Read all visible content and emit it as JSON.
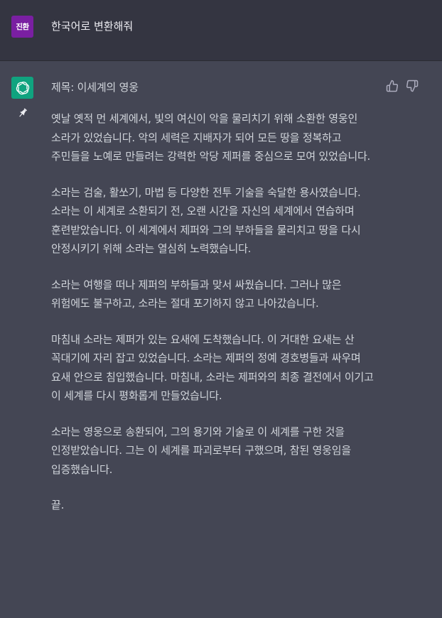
{
  "user": {
    "avatar_text": "진환",
    "avatar_color": "#7a1fa2",
    "message": "한국어로 변환해줘"
  },
  "assistant": {
    "avatar_icon": "openai-logo-icon",
    "avatar_color": "#10a37f",
    "title": "제목: 이세계의 영웅",
    "paragraphs": [
      "옛날 옛적 먼 세계에서, 빛의 여신이 악을 물리치기 위해 소환한 영웅인 소라가 있었습니다. 악의 세력은 지배자가 되어 모든 땅을 정복하고 주민들을 노예로 만들려는 강력한 악당 제퍼를 중심으로 모여 있었습니다.",
      "소라는 검술, 활쏘기, 마법 등 다양한 전투 기술을 숙달한 용사였습니다. 소라는 이 세계로 소환되기 전, 오랜 시간을 자신의 세계에서 연습하며 훈련받았습니다. 이 세계에서 제퍼와 그의 부하들을 물리치고 땅을 다시 안정시키기 위해 소라는 열심히 노력했습니다.",
      "소라는 여행을 떠나 제퍼의 부하들과 맞서 싸웠습니다. 그러나 많은 위험에도 불구하고, 소라는 절대 포기하지 않고 나아갔습니다.",
      "마침내 소라는 제퍼가 있는 요새에 도착했습니다. 이 거대한 요새는 산 꼭대기에 자리 잡고 있었습니다. 소라는 제퍼의 정예 경호병들과 싸우며 요새 안으로 침입했습니다. 마침내, 소라는 제퍼와의 최종 결전에서 이기고 이 세계를 다시 평화롭게 만들었습니다.",
      "소라는 영웅으로 송환되어, 그의 용기와 기술로 이 세계를 구한 것을 인정받았습니다. 그는 이 세계를 파괴로부터 구했으며, 참된 영웅임을 입증했습니다.",
      "끝."
    ]
  },
  "theme": {
    "user_bg": "#343541",
    "assistant_bg": "#444654",
    "text_color": "#d1d5db"
  }
}
